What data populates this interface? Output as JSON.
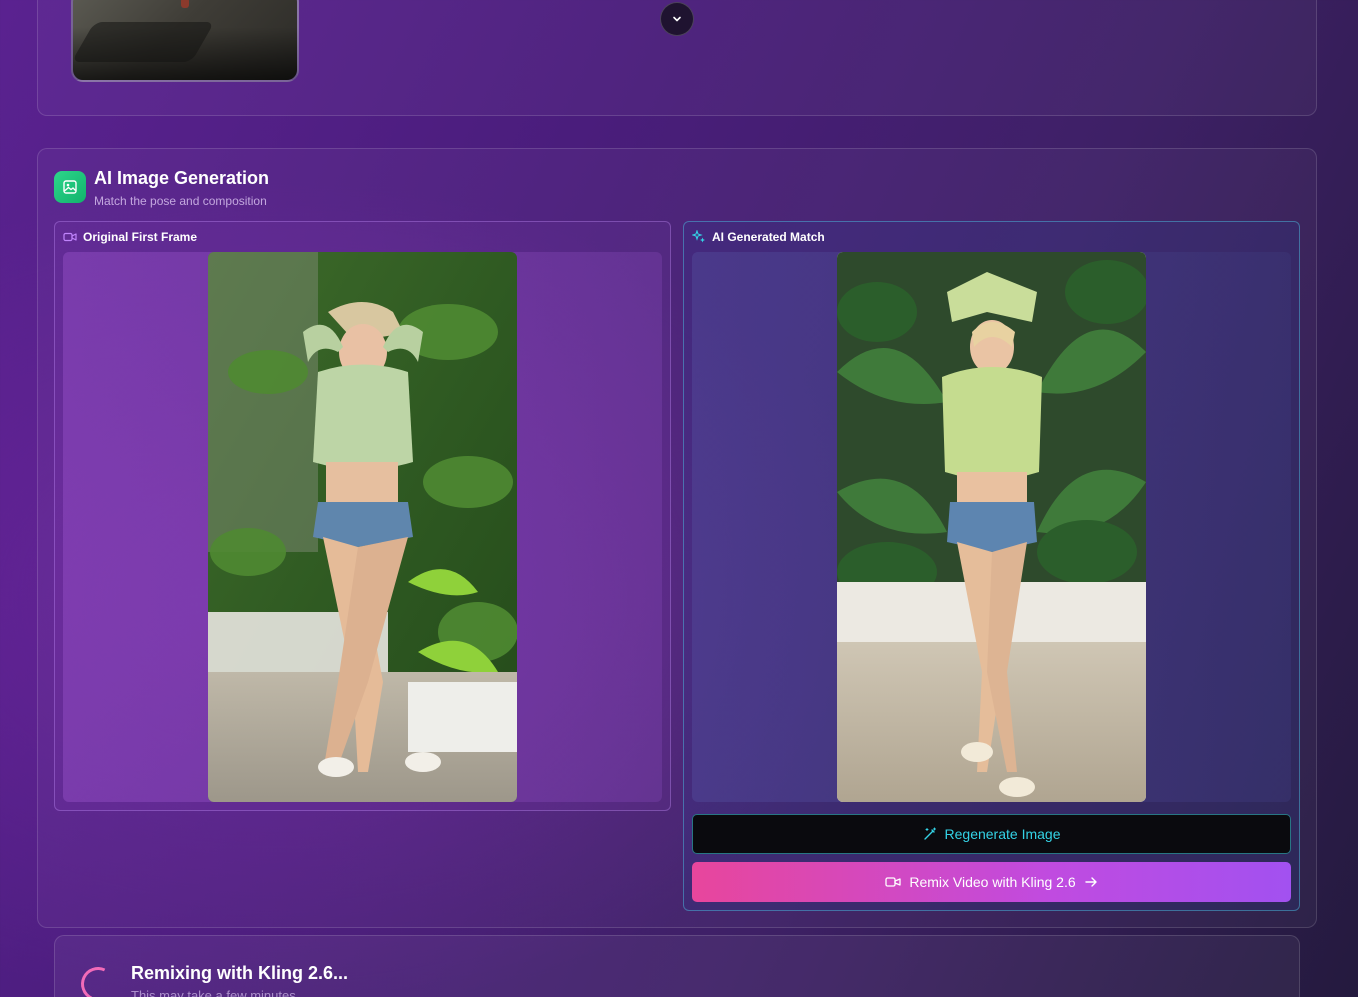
{
  "previous_section": {
    "thumbnail_icon": "previous-image-thumbnail",
    "scroll_icon": "chevron-down-icon"
  },
  "generation": {
    "icon": "image-icon",
    "icon_color": "#22c97a",
    "title": "AI Image Generation",
    "subtitle": "Match the pose and composition",
    "original": {
      "icon": "video-camera-icon",
      "label": "Original First Frame"
    },
    "generated": {
      "icon": "sparkles-icon",
      "label": "AI Generated Match"
    },
    "buttons": {
      "regenerate": {
        "icon": "magic-wand-icon",
        "label": "Regenerate Image",
        "color": "#34d3e6"
      },
      "remix": {
        "icon": "video-camera-icon",
        "label": "Remix Video with Kling 2.6",
        "trailing_icon": "arrow-right-icon"
      }
    }
  },
  "remix_status": {
    "icon": "spinner-icon",
    "title": "Remixing with Kling 2.6...",
    "subtitle": "This may take a few minutes"
  }
}
